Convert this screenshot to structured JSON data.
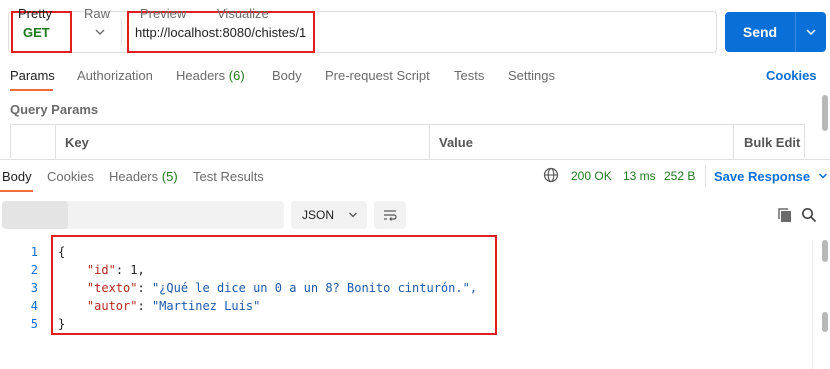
{
  "request": {
    "method": "GET",
    "url": "http://localhost:8080/chistes/1",
    "send_label": "Send"
  },
  "request_tabs": [
    {
      "label": "Params",
      "active": true
    },
    {
      "label": "Authorization"
    },
    {
      "label": "Headers",
      "count": "(6)"
    },
    {
      "label": "Body"
    },
    {
      "label": "Pre-request Script"
    },
    {
      "label": "Tests"
    },
    {
      "label": "Settings"
    }
  ],
  "cookies_label": "Cookies",
  "query_params": {
    "title": "Query Params",
    "columns": [
      "Key",
      "Value",
      "Bulk Edit"
    ]
  },
  "response_tabs": [
    {
      "label": "Body",
      "active": true
    },
    {
      "label": "Cookies"
    },
    {
      "label": "Headers",
      "count": "(5)"
    },
    {
      "label": "Test Results"
    }
  ],
  "response_status": {
    "status": "200 OK",
    "time": "13 ms",
    "size": "252 B",
    "save_label": "Save Response"
  },
  "view_modes": [
    "Pretty",
    "Raw",
    "Preview",
    "Visualize"
  ],
  "format": "JSON",
  "code_lines": [
    {
      "n": "1",
      "text": "{"
    },
    {
      "n": "2",
      "key": "\"id\"",
      "value": "1,"
    },
    {
      "n": "3",
      "key": "\"texto\"",
      "value": "\"¿Qué le dice un 0 a un 8? Bonito cinturón.\","
    },
    {
      "n": "4",
      "key": "\"autor\"",
      "value": "\"Martinez Luis\""
    },
    {
      "n": "5",
      "text": "}"
    }
  ],
  "colors": {
    "accent": "#0b6fd8",
    "method": "#1f7a1f",
    "highlight_border": "#e02020",
    "active_tab": "#f26b3a"
  }
}
